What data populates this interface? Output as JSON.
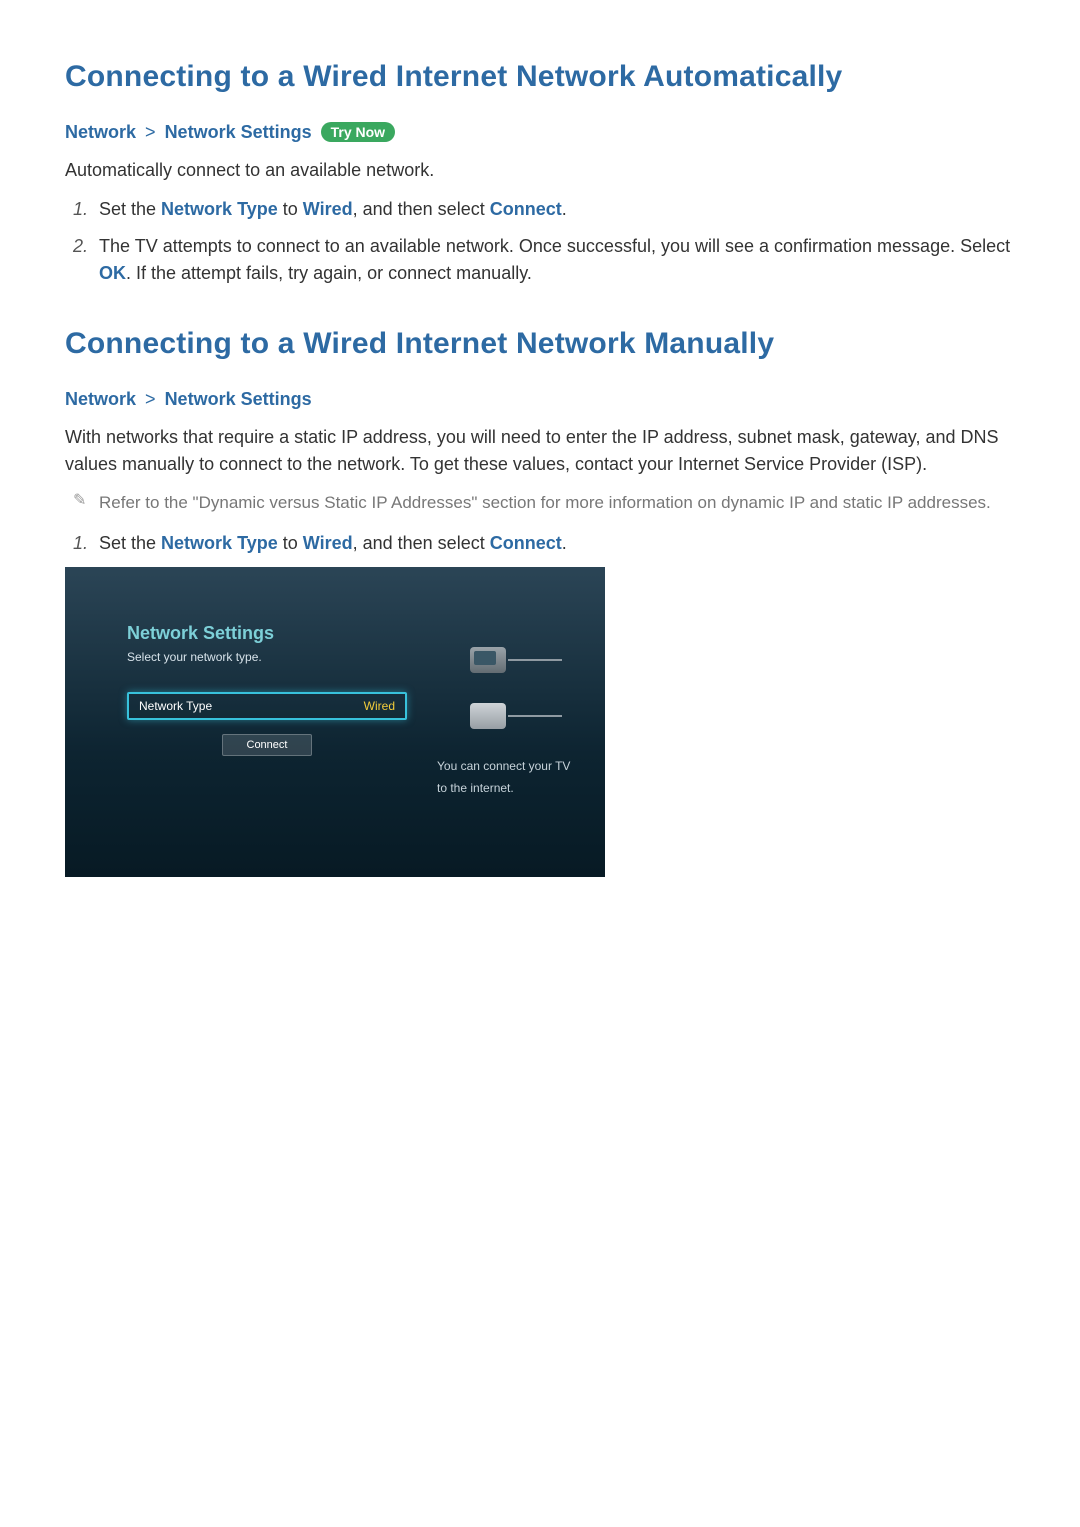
{
  "section_auto": {
    "heading": "Connecting to a Wired Internet Network Automatically",
    "breadcrumb": {
      "a": "Network",
      "sep": ">",
      "b": "Network Settings",
      "badge": "Try Now"
    },
    "intro": "Automatically connect to an available network.",
    "steps": [
      {
        "num": "1.",
        "pre": "Set the ",
        "k1": "Network Type",
        "mid": " to ",
        "k2": "Wired",
        "mid2": ", and then select ",
        "k3": "Connect",
        "tail": "."
      },
      {
        "num": "2.",
        "pre": "The TV attempts to connect to an available network. Once successful, you will see a confirmation message. Select ",
        "k1": "OK",
        "tail": ". If the attempt fails, try again, or connect manually."
      }
    ]
  },
  "section_manual": {
    "heading": "Connecting to a Wired Internet Network Manually",
    "breadcrumb": {
      "a": "Network",
      "sep": ">",
      "b": "Network Settings"
    },
    "intro": "With networks that require a static IP address, you will need to enter the IP address, subnet mask, gateway, and DNS values manually to connect to the network. To get these values, contact your Internet Service Provider (ISP).",
    "note": "Refer to the \"Dynamic versus Static IP Addresses\" section for more information on dynamic IP and static IP addresses.",
    "step1": {
      "num": "1.",
      "pre": "Set the ",
      "k1": "Network Type",
      "mid": " to ",
      "k2": "Wired",
      "mid2": ", and then select ",
      "k3": "Connect",
      "tail": "."
    }
  },
  "tv": {
    "title": "Network Settings",
    "subtitle": "Select your network type.",
    "select_label": "Network Type",
    "select_value": "Wired",
    "connect_label": "Connect",
    "desc_line1": "You can connect your TV",
    "desc_line2": "to the internet."
  }
}
